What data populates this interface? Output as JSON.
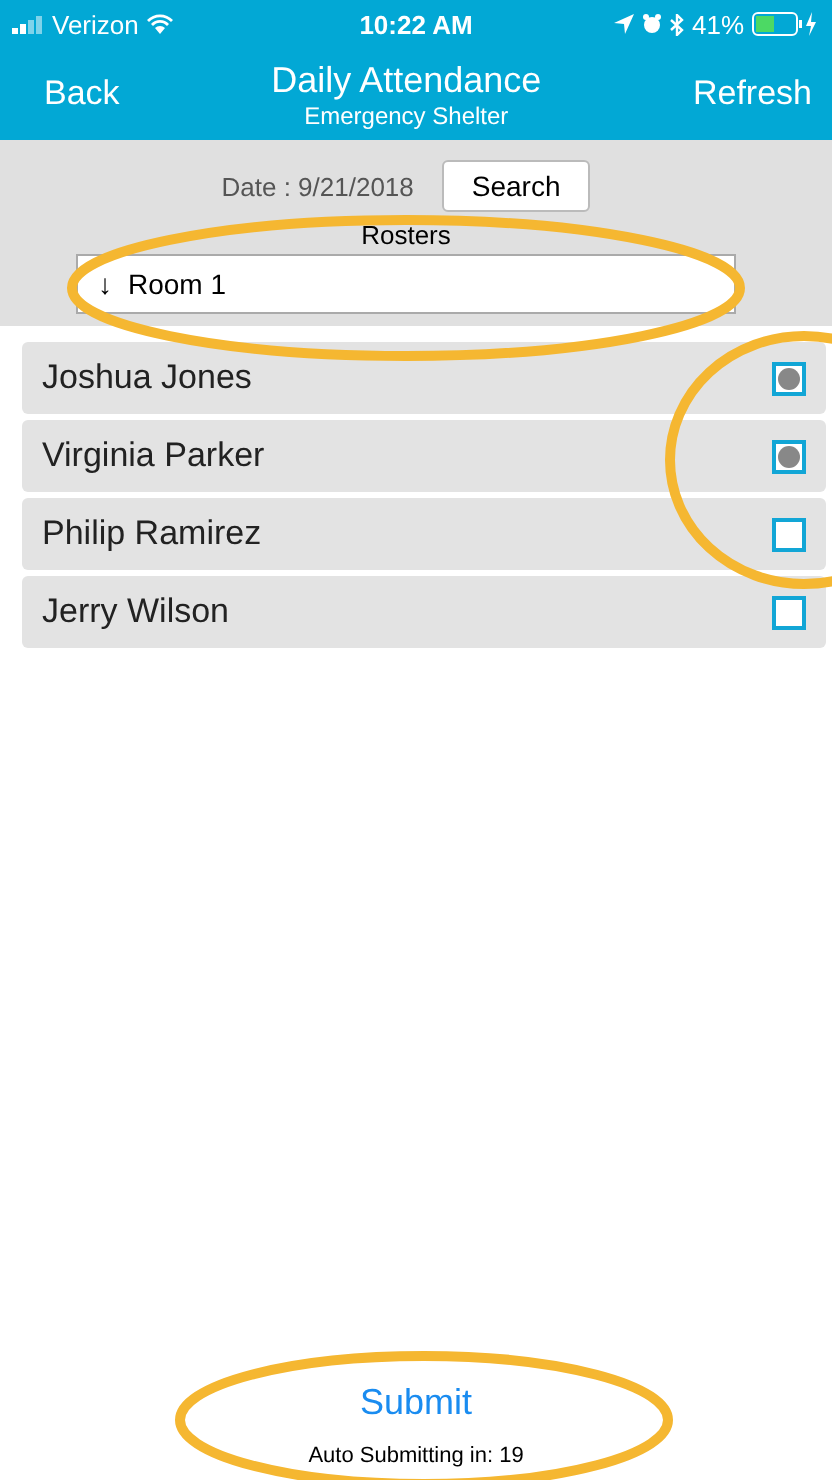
{
  "status_bar": {
    "carrier": "Verizon",
    "time": "10:22 AM",
    "battery": "41%"
  },
  "nav": {
    "back": "Back",
    "title": "Daily Attendance",
    "subtitle": "Emergency Shelter",
    "refresh": "Refresh"
  },
  "filter": {
    "date": "Date : 9/21/2018",
    "search": "Search",
    "rosters_label": "Rosters",
    "arrow": "↓",
    "roster": "Room 1"
  },
  "people": [
    {
      "name": "Joshua Jones",
      "checked": true
    },
    {
      "name": "Virginia Parker",
      "checked": true
    },
    {
      "name": "Philip Ramirez",
      "checked": false
    },
    {
      "name": "Jerry Wilson",
      "checked": false
    }
  ],
  "footer": {
    "submit": "Submit",
    "auto": "Auto Submitting in: 19"
  }
}
